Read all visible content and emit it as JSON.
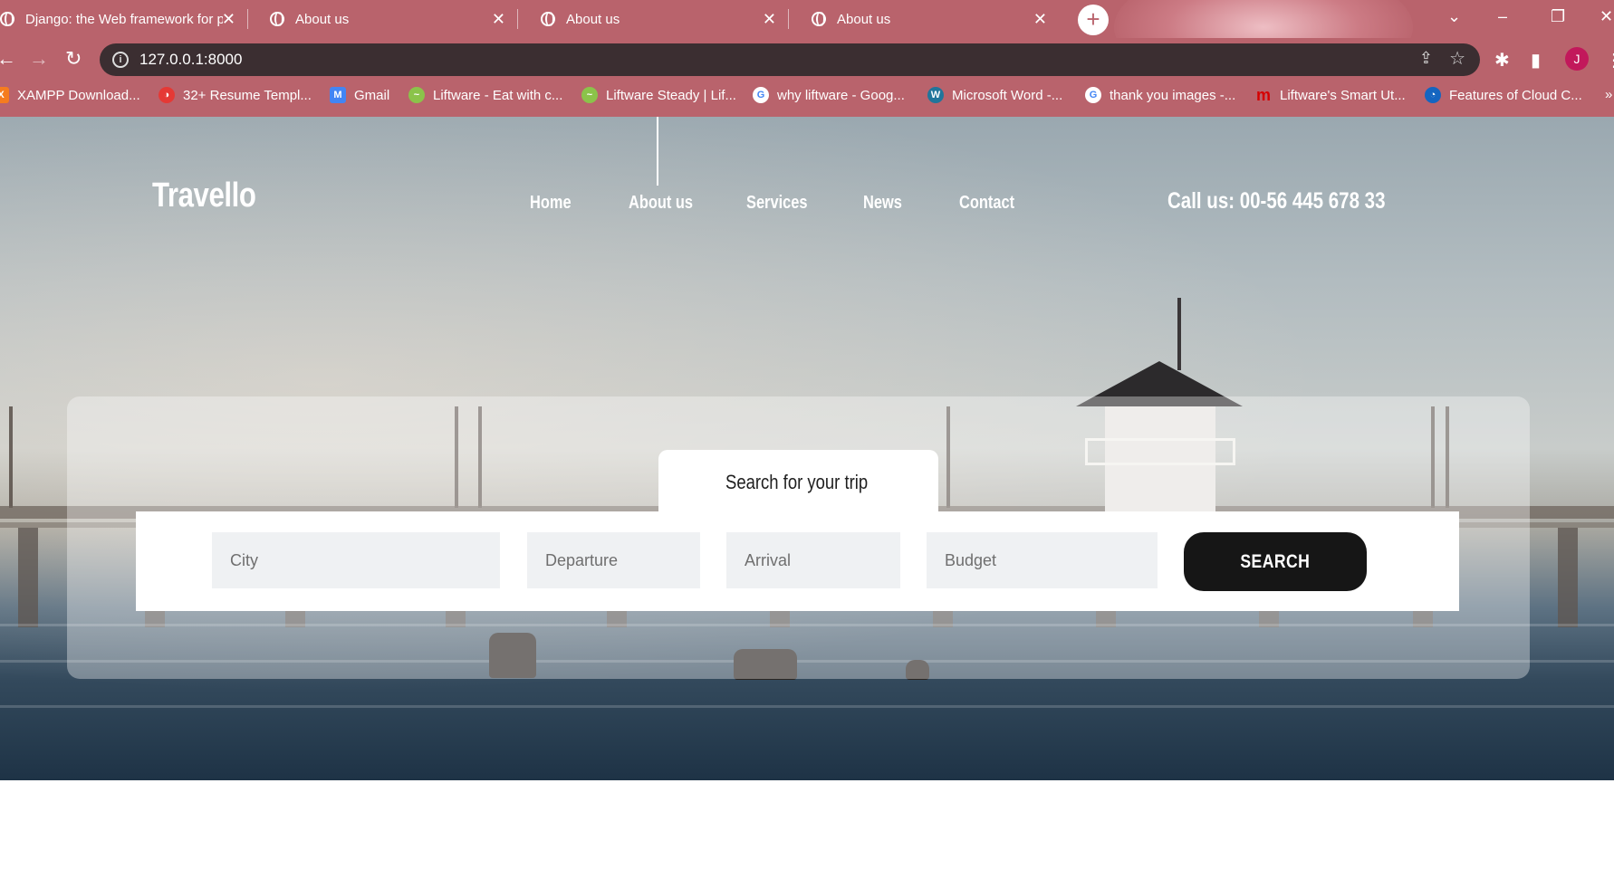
{
  "browser": {
    "tabs": [
      {
        "title": "Django: the Web framework for p"
      },
      {
        "title": "About us"
      },
      {
        "title": "About us"
      },
      {
        "title": "About us"
      }
    ],
    "new_tab_symbol": "+",
    "url": "127.0.0.1:8000",
    "profile_initial": "J",
    "bookmarks": [
      {
        "label": "XAMPP Download...",
        "icon": "xampp-icon",
        "color": "#f57c1f"
      },
      {
        "label": "32+ Resume Templ...",
        "icon": "resume-icon",
        "color": "#e53935"
      },
      {
        "label": "Gmail",
        "icon": "gmail-icon",
        "color": "#4285f4"
      },
      {
        "label": "Liftware - Eat with c...",
        "icon": "liftware-icon",
        "color": "#8bc34a"
      },
      {
        "label": "Liftware Steady | Lif...",
        "icon": "liftware-icon",
        "color": "#8bc34a"
      },
      {
        "label": "why liftware - Goog...",
        "icon": "google-icon",
        "color": "#ffffff"
      },
      {
        "label": "Microsoft Word -...",
        "icon": "wordpress-icon",
        "color": "#21759b"
      },
      {
        "label": "thank you images -...",
        "icon": "google-icon",
        "color": "#ffffff"
      },
      {
        "label": "Liftware's Smart Ut...",
        "icon": "m-logo-icon",
        "color": "#d50000"
      },
      {
        "label": "Features of Cloud C...",
        "icon": "cloud-icon",
        "color": "#1565c0"
      }
    ],
    "chrome_color": "#b9636c"
  },
  "site": {
    "logo": "Travello",
    "nav": [
      {
        "label": "Home"
      },
      {
        "label": "About us"
      },
      {
        "label": "Services"
      },
      {
        "label": "News"
      },
      {
        "label": "Contact"
      }
    ],
    "call_us": "Call us: 00-56 445 678 33",
    "search": {
      "tab_label": "Search for your trip",
      "fields": [
        {
          "placeholder": "City"
        },
        {
          "placeholder": "Departure"
        },
        {
          "placeholder": "Arrival"
        },
        {
          "placeholder": "Budget"
        }
      ],
      "button_label": "SEARCH",
      "button_color": "#161616"
    }
  }
}
